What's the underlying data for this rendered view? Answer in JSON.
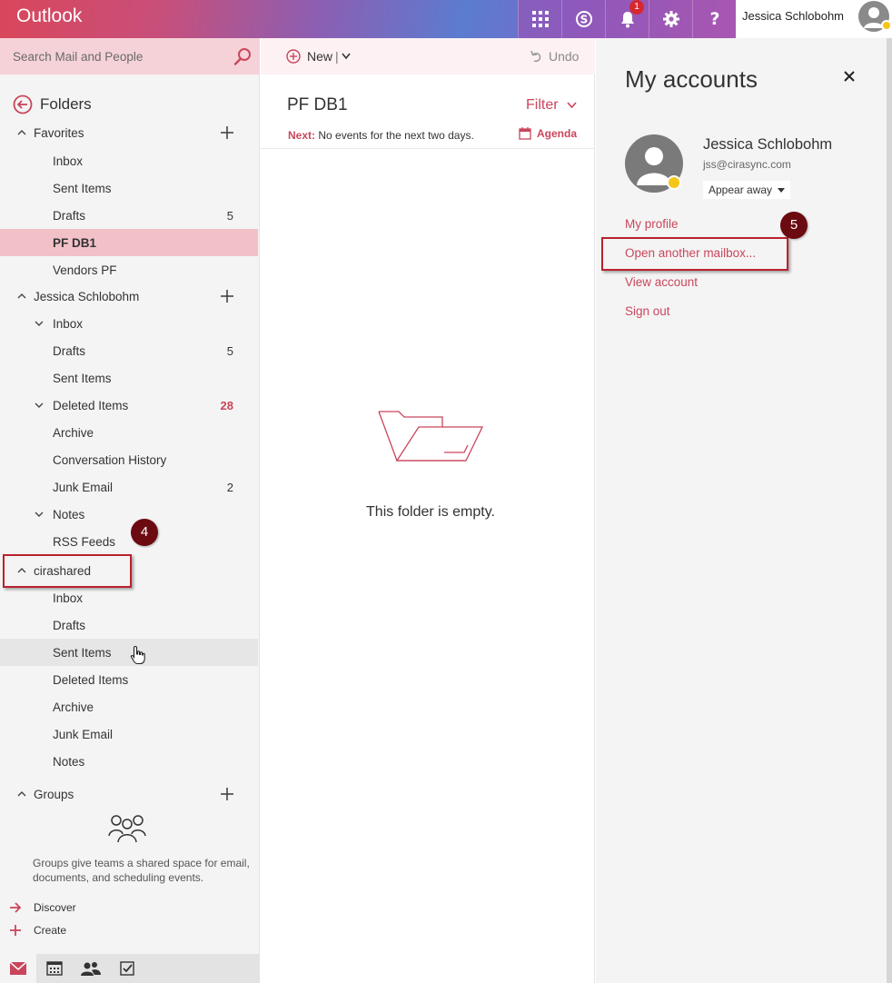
{
  "app": {
    "title": "Outlook"
  },
  "topbar": {
    "notification_count": "1",
    "user_name": "Jessica Schlobohm"
  },
  "search": {
    "placeholder": "Search Mail and People"
  },
  "nav": {
    "folders_label": "Folders",
    "favorites": {
      "label": "Favorites",
      "items": [
        {
          "label": "Inbox",
          "count": ""
        },
        {
          "label": "Sent Items",
          "count": ""
        },
        {
          "label": "Drafts",
          "count": "5"
        },
        {
          "label": "PF DB1",
          "count": ""
        },
        {
          "label": "Vendors PF",
          "count": ""
        }
      ]
    },
    "account": {
      "label": "Jessica Schlobohm",
      "items": [
        {
          "label": "Inbox",
          "count": ""
        },
        {
          "label": "Drafts",
          "count": "5"
        },
        {
          "label": "Sent Items",
          "count": ""
        },
        {
          "label": "Deleted Items",
          "count": "28"
        },
        {
          "label": "Archive",
          "count": ""
        },
        {
          "label": "Conversation History",
          "count": ""
        },
        {
          "label": "Junk Email",
          "count": "2"
        },
        {
          "label": "Notes",
          "count": ""
        },
        {
          "label": "RSS Feeds",
          "count": ""
        }
      ]
    },
    "shared": {
      "label": "cirashared",
      "items": [
        {
          "label": "Inbox"
        },
        {
          "label": "Drafts"
        },
        {
          "label": "Sent Items"
        },
        {
          "label": "Deleted Items"
        },
        {
          "label": "Archive"
        },
        {
          "label": "Junk Email"
        },
        {
          "label": "Notes"
        }
      ]
    },
    "groups": {
      "label": "Groups",
      "description": "Groups give teams a shared space for email, documents, and scheduling events.",
      "discover": "Discover",
      "create": "Create"
    }
  },
  "callouts": {
    "step4": "4",
    "step5": "5"
  },
  "toolbar": {
    "new_label": "New",
    "undo_label": "Undo"
  },
  "folder": {
    "title": "PF DB1",
    "filter_label": "Filter",
    "next_label": "Next:",
    "next_text": "No events for the next two days.",
    "agenda_label": "Agenda",
    "empty_text": "This folder is empty."
  },
  "accounts_panel": {
    "title": "My accounts",
    "name": "Jessica Schlobohm",
    "email": "jss@cirasync.com",
    "status": "Appear away",
    "links": [
      "My profile",
      "Open another mailbox...",
      "View account",
      "Sign out"
    ]
  },
  "colors": {
    "accent": "#c9465c",
    "selected": "#f2c1c8",
    "callout": "#b9222f",
    "badge": "#6b0a10"
  }
}
